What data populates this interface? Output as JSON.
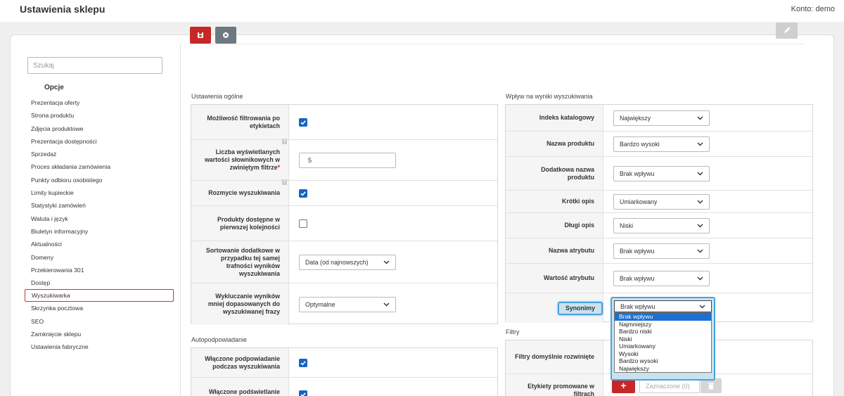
{
  "app": {
    "title": "Ustawienia sklepu",
    "account": "Konto: demo"
  },
  "sidebar": {
    "search_placeholder": "Szukaj",
    "heading": "Opcje",
    "items": [
      "Prezentacja oferty",
      "Strona produktu",
      "Zdjęcia produktowe",
      "Prezentacja dostępności",
      "Sprzedaż",
      "Proces składania zamówienia",
      "Punkty odbioru osobistego",
      "Limity kupieckie",
      "Statystyki zamówień",
      "Waluta i język",
      "Biuletyn informacyjny",
      "Aktualności",
      "Domeny",
      "Przekierowania 301",
      "Dostęp",
      "Wyszukiwarka",
      "Skrzynka pocztowa",
      "SEO",
      "Zamknięcie sklepu",
      "Ustawienia fabryczne"
    ],
    "active_index": 15
  },
  "toolbar": {
    "save_icon": "floppy-disk-icon",
    "cancel_icon": "close-circle-icon",
    "edit_icon": "pencil-icon"
  },
  "general": {
    "title": "Ustawienia ogólne",
    "filter_by_tags": {
      "label": "Możliwość filtrowania po etykietach",
      "checked": true
    },
    "dict_values_count": {
      "label": "Liczba wyświetlanych wartości słownikowych w zwiniętym filtrze",
      "required_mark": "*",
      "help": "?",
      "value": "5"
    },
    "search_fuzziness": {
      "label": "Rozmycie wyszukiwania",
      "help": "?",
      "checked": true
    },
    "available_first": {
      "label": "Produkty dostępne w pierwszej kolejności",
      "checked": false
    },
    "secondary_sort": {
      "label": "Sortowanie dodatkowe w przypadku tej samej trafności wyników wyszukiwania",
      "value": "Data (od najnowszych)"
    },
    "exclude_less_matching": {
      "label": "Wykluczanie wyników mniej dopasowanych do wyszukiwanej frazy",
      "value": "Optymalne"
    }
  },
  "autocomplete": {
    "title": "Autopodpowiadanie",
    "enabled": {
      "label": "Włączone podpowiadanie podczas wyszukiwania",
      "checked": true
    },
    "highlight": {
      "label": "Włączone podświetlanie",
      "checked": true
    }
  },
  "impact": {
    "title": "Wpływ na wyniki wyszukiwania",
    "rows": [
      {
        "label": "Indeks katalogowy",
        "value": "Największy"
      },
      {
        "label": "Nazwa produktu",
        "value": "Bardzo wysoki"
      },
      {
        "label": "Dodatkowa nazwa produktu",
        "value": "Brak wpływu"
      },
      {
        "label": "Krótki opis",
        "value": "Umiarkowany"
      },
      {
        "label": "Długi opis",
        "value": "Niski"
      },
      {
        "label": "Nazwa atrybutu",
        "value": "Brak wpływu"
      },
      {
        "label": "Wartość atrybutu",
        "value": "Brak wpływu"
      }
    ],
    "synonyms": {
      "label": "Synonimy",
      "value": "Brak wpływu",
      "options": [
        "Brak wpływu",
        "Najmniejszy",
        "Bardzo niski",
        "Niski",
        "Umiarkowany",
        "Wysoki",
        "Bardzo wysoki",
        "Największy"
      ],
      "highlighted_index": 0
    }
  },
  "filters": {
    "title": "Filtry",
    "default_expanded": {
      "label": "Filtry domyślnie rozwinięte"
    },
    "promoted_tags": {
      "label": "Etykiety promowane w filtrach",
      "add_label": "+",
      "selected_text": "Zaznaczone (0)"
    }
  },
  "colors": {
    "accent_red": "#c62828",
    "highlight_blue": "#4aa3df",
    "highlight_bg": "#c8e2ef",
    "checkbox_blue": "#1565c0"
  }
}
